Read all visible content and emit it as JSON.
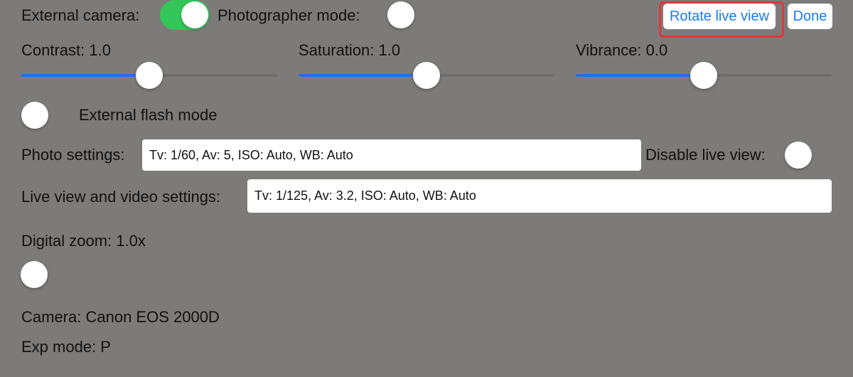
{
  "top_bar": {
    "external_camera_label": "External camera:",
    "external_camera_on": true,
    "photographer_mode_label": "Photographer mode:",
    "photographer_mode_on": false,
    "rotate_live_view_label": "Rotate live view",
    "done_label": "Done"
  },
  "sliders": [
    {
      "label": "Contrast: 1.0",
      "fraction": 0.5
    },
    {
      "label": "Saturation: 1.0",
      "fraction": 0.5
    },
    {
      "label": "Vibrance: 0.0",
      "fraction": 0.5
    }
  ],
  "external_flash": {
    "label": "External flash mode",
    "on": false
  },
  "photo_settings": {
    "label": "Photo settings:",
    "value": "Tv: 1/60, Av: 5, ISO: Auto, WB: Auto"
  },
  "disable_live_view": {
    "label": "Disable live view:",
    "on": false
  },
  "live_view_settings": {
    "label": "Live view and video settings:",
    "value": "Tv: 1/125, Av: 3.2, ISO: Auto, WB: Auto"
  },
  "digital_zoom": {
    "label": "Digital zoom: 1.0x",
    "fraction": 0.0
  },
  "info": {
    "camera": "Camera: Canon EOS 2000D",
    "exp_mode": "Exp mode: P"
  },
  "colors": {
    "background": "#7d7b7a",
    "switch_on": "#35c659",
    "slider_fill": "#1f6ff2",
    "link_blue": "#1a7ce8",
    "highlight_red": "#e5333b"
  }
}
